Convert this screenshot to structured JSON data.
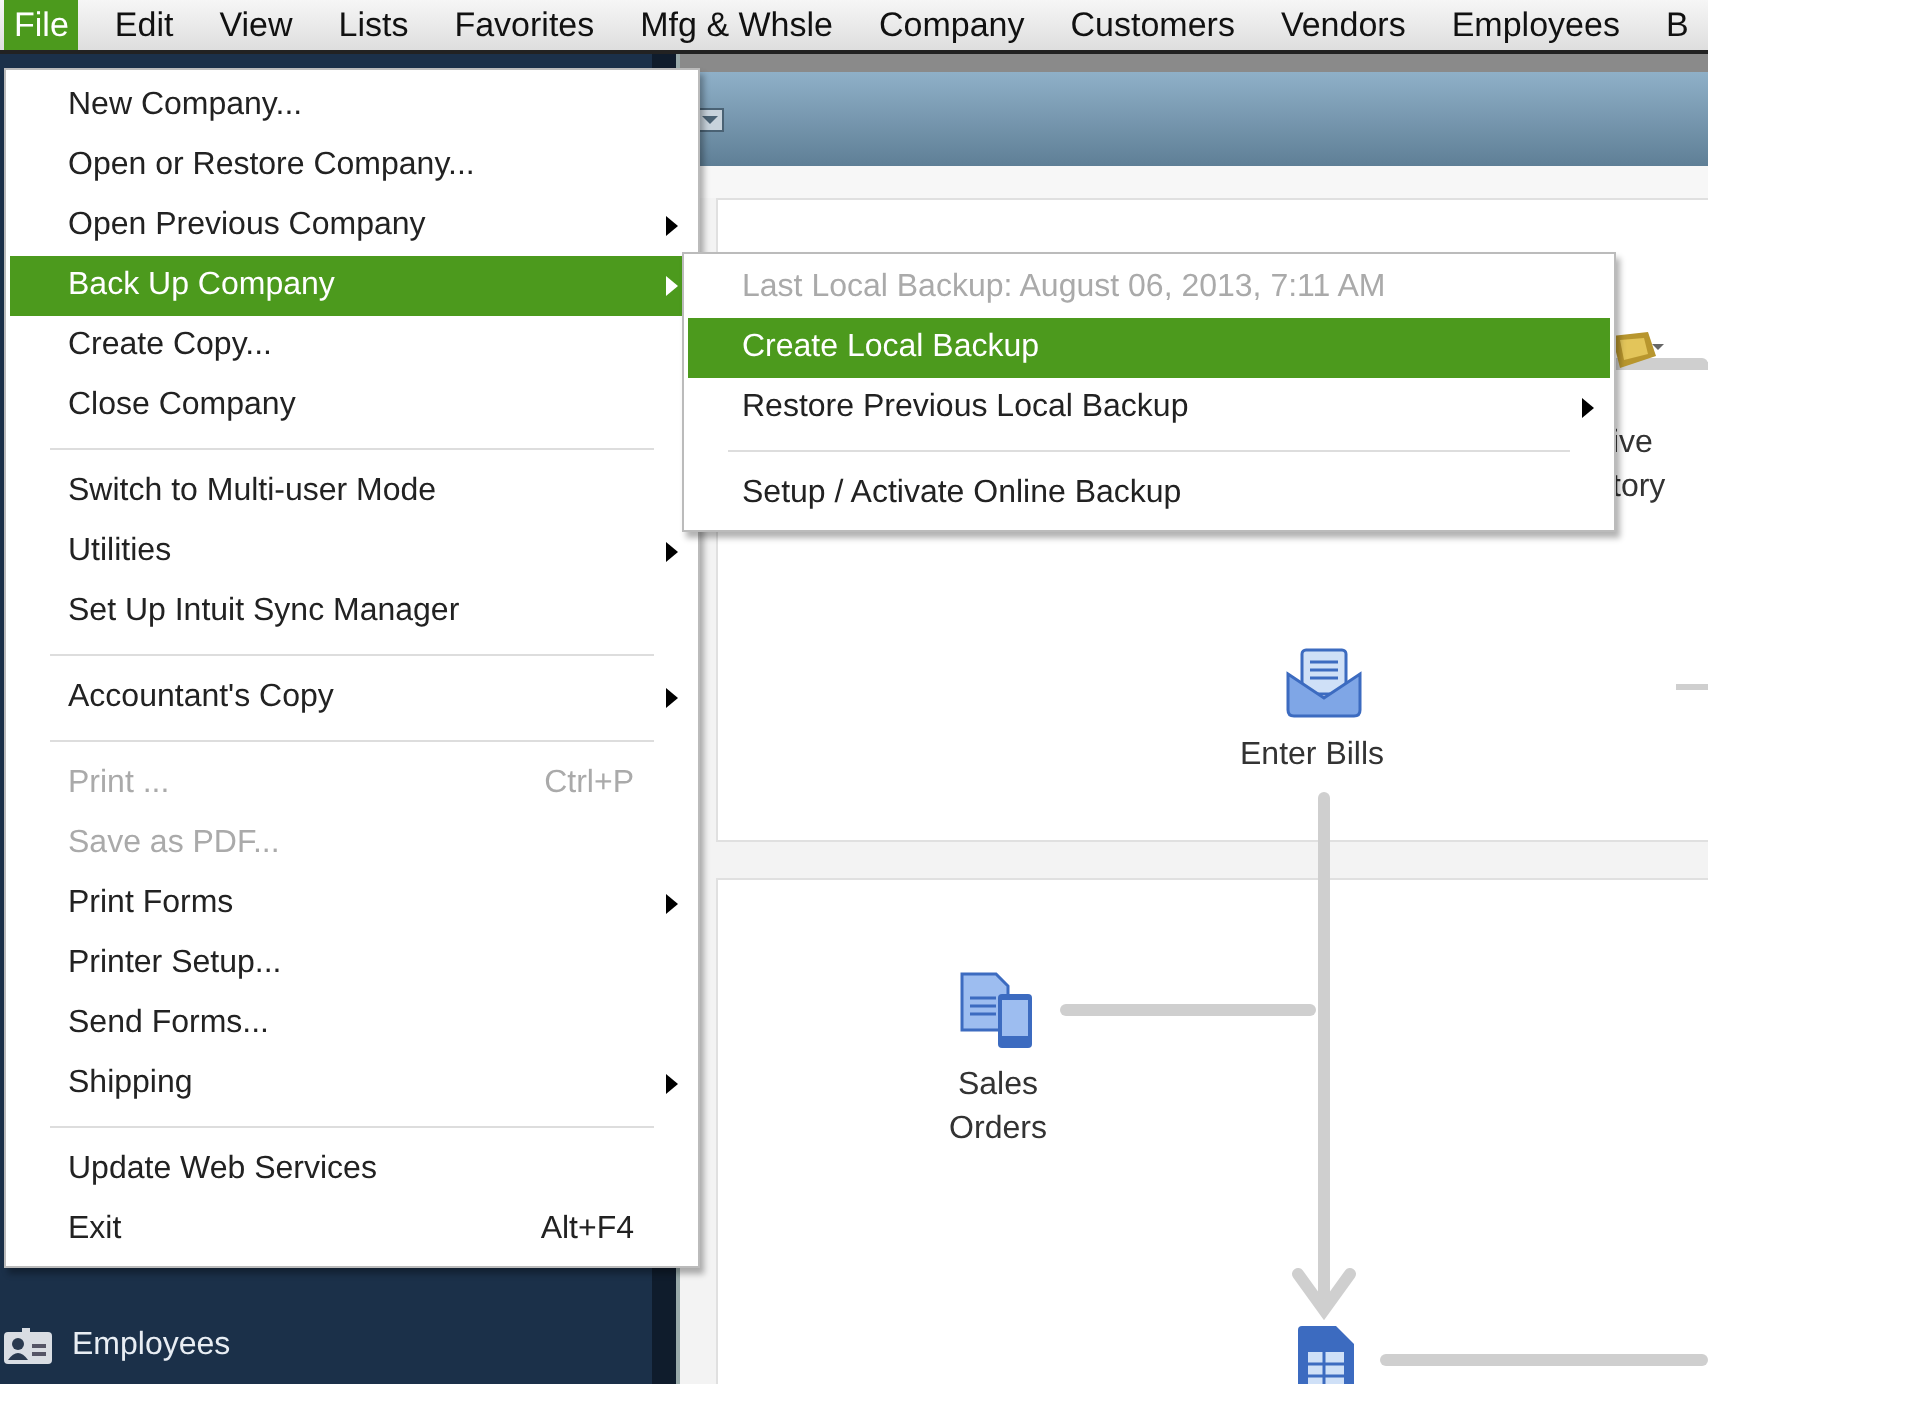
{
  "menubar": [
    {
      "label": "File",
      "selected": true
    },
    {
      "label": "Edit",
      "selected": false
    },
    {
      "label": "View",
      "selected": false
    },
    {
      "label": "Lists",
      "selected": false
    },
    {
      "label": "Favorites",
      "selected": false
    },
    {
      "label": "Mfg & Whsle",
      "selected": false
    },
    {
      "label": "Company",
      "selected": false
    },
    {
      "label": "Customers",
      "selected": false
    },
    {
      "label": "Vendors",
      "selected": false
    },
    {
      "label": "Employees",
      "selected": false
    },
    {
      "label": "B",
      "selected": false
    }
  ],
  "file_menu": [
    {
      "kind": "item",
      "label": "New Company...",
      "disabled": false,
      "selected": false,
      "submenu": false
    },
    {
      "kind": "item",
      "label": "Open or Restore Company...",
      "disabled": false,
      "selected": false,
      "submenu": false
    },
    {
      "kind": "item",
      "label": "Open Previous Company",
      "disabled": false,
      "selected": false,
      "submenu": true
    },
    {
      "kind": "item",
      "label": "Back Up Company",
      "disabled": false,
      "selected": true,
      "submenu": true
    },
    {
      "kind": "item",
      "label": "Create Copy...",
      "disabled": false,
      "selected": false,
      "submenu": false
    },
    {
      "kind": "item",
      "label": "Close Company",
      "disabled": false,
      "selected": false,
      "submenu": false
    },
    {
      "kind": "separator"
    },
    {
      "kind": "item",
      "label": "Switch to Multi-user Mode",
      "disabled": false,
      "selected": false,
      "submenu": false
    },
    {
      "kind": "item",
      "label": "Utilities",
      "disabled": false,
      "selected": false,
      "submenu": true
    },
    {
      "kind": "item",
      "label": "Set Up Intuit Sync Manager",
      "disabled": false,
      "selected": false,
      "submenu": false
    },
    {
      "kind": "separator"
    },
    {
      "kind": "item",
      "label": "Accountant's Copy",
      "disabled": false,
      "selected": false,
      "submenu": true
    },
    {
      "kind": "separator"
    },
    {
      "kind": "item",
      "label": "Print ...",
      "disabled": true,
      "selected": false,
      "submenu": false,
      "shortcut": "Ctrl+P"
    },
    {
      "kind": "item",
      "label": "Save as PDF...",
      "disabled": true,
      "selected": false,
      "submenu": false
    },
    {
      "kind": "item",
      "label": "Print Forms",
      "disabled": false,
      "selected": false,
      "submenu": true
    },
    {
      "kind": "item",
      "label": "Printer Setup...",
      "disabled": false,
      "selected": false,
      "submenu": false
    },
    {
      "kind": "item",
      "label": "Send Forms...",
      "disabled": false,
      "selected": false,
      "submenu": false
    },
    {
      "kind": "item",
      "label": "Shipping",
      "disabled": false,
      "selected": false,
      "submenu": true
    },
    {
      "kind": "separator"
    },
    {
      "kind": "item",
      "label": "Update Web Services",
      "disabled": false,
      "selected": false,
      "submenu": false
    },
    {
      "kind": "item",
      "label": "Exit",
      "disabled": false,
      "selected": false,
      "submenu": false,
      "shortcut": "Alt+F4"
    }
  ],
  "backup_submenu": [
    {
      "kind": "item",
      "label": "Last Local Backup: August 06, 2013, 7:11 AM",
      "disabled": true,
      "selected": false,
      "submenu": false
    },
    {
      "kind": "item",
      "label": "Create Local Backup",
      "disabled": false,
      "selected": true,
      "submenu": false
    },
    {
      "kind": "item",
      "label": "Restore Previous Local Backup",
      "disabled": false,
      "selected": false,
      "submenu": true
    },
    {
      "kind": "separator"
    },
    {
      "kind": "item",
      "label": "Setup / Activate Online Backup",
      "disabled": false,
      "selected": false,
      "submenu": false
    }
  ],
  "sidebar": {
    "items": [
      {
        "label": "Employees"
      }
    ]
  },
  "diagram": {
    "nodes": [
      {
        "label": "Enter Bills"
      },
      {
        "label": "Sales Orders"
      }
    ],
    "partial_labels": [
      "ive",
      "tory"
    ]
  }
}
